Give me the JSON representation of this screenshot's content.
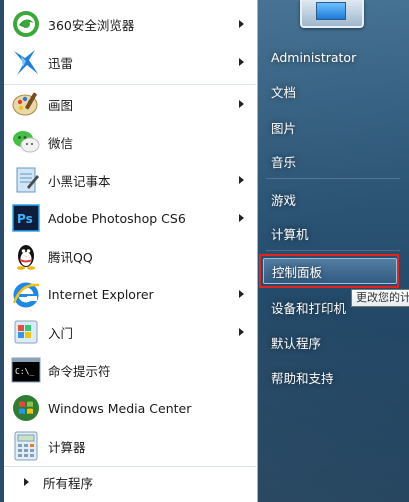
{
  "left_menu": {
    "items": [
      {
        "label": "360安全浏览器",
        "has_submenu": true
      },
      {
        "label": "迅雷",
        "has_submenu": true
      },
      {
        "label": "画图",
        "has_submenu": true
      },
      {
        "label": "微信",
        "has_submenu": false
      },
      {
        "label": "小黑记事本",
        "has_submenu": true
      },
      {
        "label": "Adobe Photoshop CS6",
        "has_submenu": true
      },
      {
        "label": "腾讯QQ",
        "has_submenu": false
      },
      {
        "label": "Internet Explorer",
        "has_submenu": true
      },
      {
        "label": "入门",
        "has_submenu": true
      },
      {
        "label": "命令提示符",
        "has_submenu": false
      },
      {
        "label": "Windows Media Center",
        "has_submenu": false
      },
      {
        "label": "计算器",
        "has_submenu": false
      }
    ],
    "all_programs": "所有程序"
  },
  "right_menu": {
    "user": "Administrator",
    "documents": "文档",
    "pictures": "图片",
    "music": "音乐",
    "games": "游戏",
    "computer": "计算机",
    "control_panel": "控制面板",
    "devices_printers": "设备和打印机",
    "default_programs": "默认程序",
    "help_support": "帮助和支持"
  },
  "tooltip": "更改您的计",
  "colors": {
    "highlight_border": "#e5221c",
    "right_panel": "#2d5677"
  }
}
